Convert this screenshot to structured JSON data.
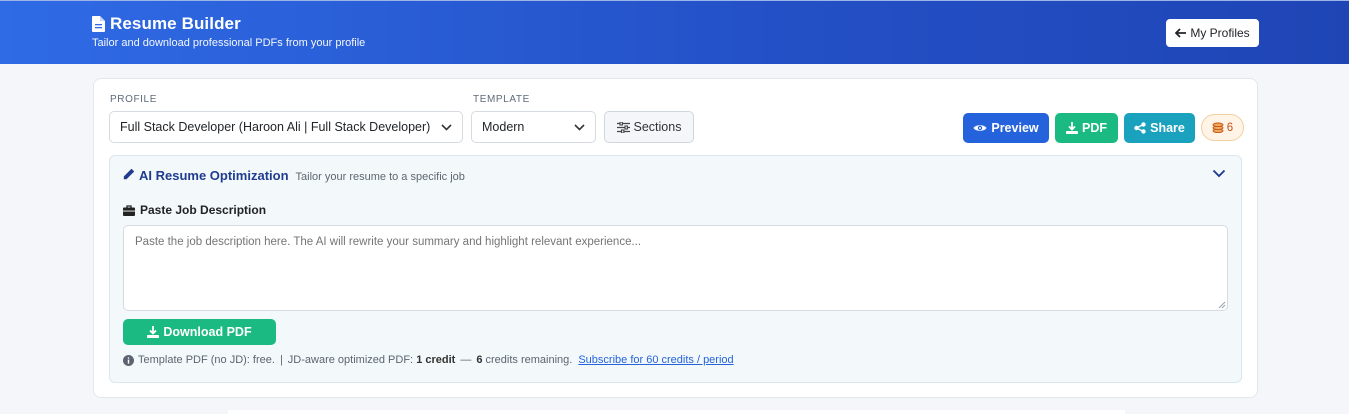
{
  "header": {
    "title": "Resume Builder",
    "subtitle": "Tailor and download professional PDFs from your profile",
    "my_profiles_label": "My Profiles",
    "icons": {
      "title": "file-text-icon",
      "back": "arrow-left-icon"
    }
  },
  "toolbar": {
    "profile_label": "PROFILE",
    "profile_value": "Full Stack Developer (Haroon Ali | Full Stack Developer)",
    "template_label": "TEMPLATE",
    "template_value": "Modern",
    "sections_label": "Sections",
    "preview_label": "Preview",
    "pdf_label": "PDF",
    "share_label": "Share",
    "credits_count": "6"
  },
  "ai_panel": {
    "title": "AI Resume Optimization",
    "subtitle": "Tailor your resume to a specific job",
    "jd_label": "Paste Job Description",
    "jd_placeholder": "Paste the job description here. The AI will rewrite your summary and highlight relevant experience...",
    "download_label": "Download PDF",
    "note": {
      "part1": "Template PDF (no JD): free.",
      "sep": "|",
      "part2": "JD-aware optimized PDF:",
      "credit_cost": "1 credit",
      "dash": "—",
      "remaining_count": "6",
      "remaining_text": "credits remaining.",
      "subscribe_link": "Subscribe for 60 credits / period"
    }
  },
  "colors": {
    "header_gradient_start": "#2f6be5",
    "header_gradient_end": "#1f45b5",
    "primary": "#2563dc",
    "success": "#1bba82",
    "info": "#1aa1bd",
    "credits_text": "#c0561c",
    "ai_title": "#1f3c8f"
  }
}
